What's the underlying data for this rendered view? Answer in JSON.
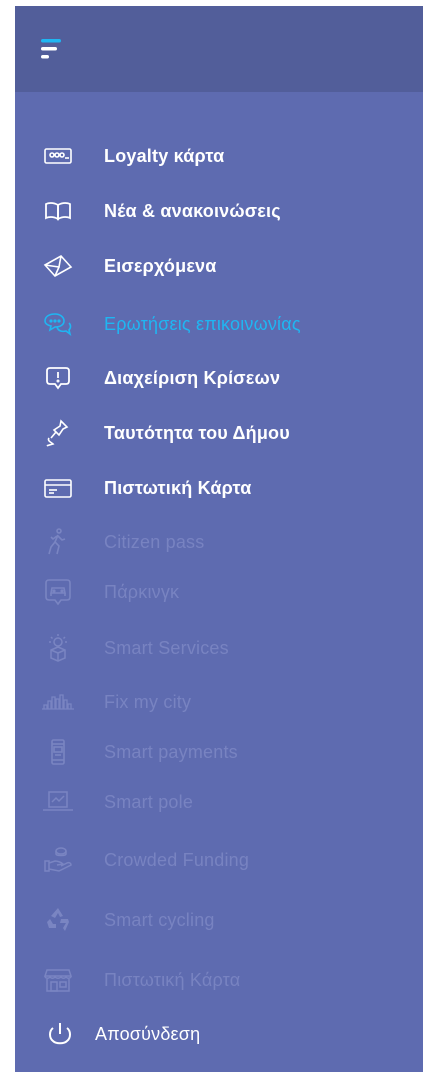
{
  "header": {
    "menu_icon": "hamburger-menu-icon",
    "accent_colors": [
      "#1fb6f2",
      "#ffffff"
    ]
  },
  "colors": {
    "panel_bg": "#5e6bb0",
    "header_bg": "#525e9a",
    "active_text": "#ffffff",
    "selected_text": "#1fb6f2",
    "disabled_text": "#7883c1"
  },
  "menu": {
    "items": [
      {
        "label": "Loyalty κάρτα",
        "icon": "loyalty-card-icon",
        "state": "active"
      },
      {
        "label": "Νέα & ανακοινώσεις",
        "icon": "open-book-icon",
        "state": "active"
      },
      {
        "label": "Εισερχόμενα",
        "icon": "envelope-icon",
        "state": "active"
      },
      {
        "label": "Ερωτήσεις επικοινωνίας",
        "icon": "chat-bubbles-icon",
        "state": "selected"
      },
      {
        "label": "Διαχείριση Κρίσεων",
        "icon": "alert-bubble-icon",
        "state": "active"
      },
      {
        "label": "Ταυτότητα του Δήμου",
        "icon": "pushpin-icon",
        "state": "active"
      },
      {
        "label": "Πιστωτική Κάρτα",
        "icon": "credit-card-icon",
        "state": "active"
      },
      {
        "label": "Citizen pass",
        "icon": "walking-person-icon",
        "state": "disabled"
      },
      {
        "label": "Πάρκινγκ",
        "icon": "parking-car-icon",
        "state": "disabled"
      },
      {
        "label": "Smart Services",
        "icon": "smart-bulb-box-icon",
        "state": "disabled"
      },
      {
        "label": "Fix my city",
        "icon": "city-skyline-icon",
        "state": "disabled"
      },
      {
        "label": "Smart payments",
        "icon": "smartphone-icon",
        "state": "disabled"
      },
      {
        "label": "Smart pole",
        "icon": "laptop-chart-icon",
        "state": "disabled"
      },
      {
        "label": "Crowded Funding",
        "icon": "hand-coin-icon",
        "state": "disabled"
      },
      {
        "label": "Smart cycling",
        "icon": "recycle-icon",
        "state": "disabled"
      },
      {
        "label": "Πιστωτική Κάρτα",
        "icon": "storefront-icon",
        "state": "disabled"
      }
    ],
    "logout": {
      "label": "Αποσύνδεση",
      "icon": "power-icon"
    }
  }
}
